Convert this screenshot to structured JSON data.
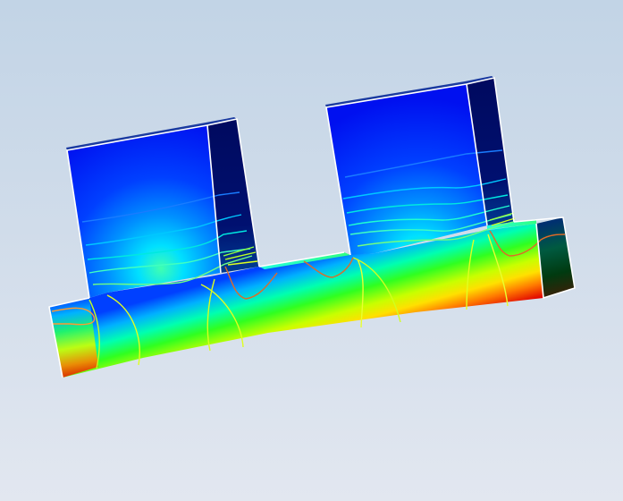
{
  "scene": {
    "view": "3D isometric",
    "object": "heat-sink",
    "background_gradient": [
      "#c2d4e6",
      "#e2e7f0"
    ],
    "colormap": [
      "#0010ff",
      "#0060ff",
      "#00d8ff",
      "#00ff80",
      "#40ff00",
      "#d8ff00",
      "#ffc000",
      "#ff3000",
      "#d00000"
    ],
    "isoline_colors": [
      "#1a7cff",
      "#00d0ff",
      "#40ffc0",
      "#80ff40",
      "#e0ff20",
      "#ff9a30",
      "#e06a28"
    ],
    "edge_color": "#ffffff",
    "legend_visible": false,
    "axes_visible": false
  }
}
